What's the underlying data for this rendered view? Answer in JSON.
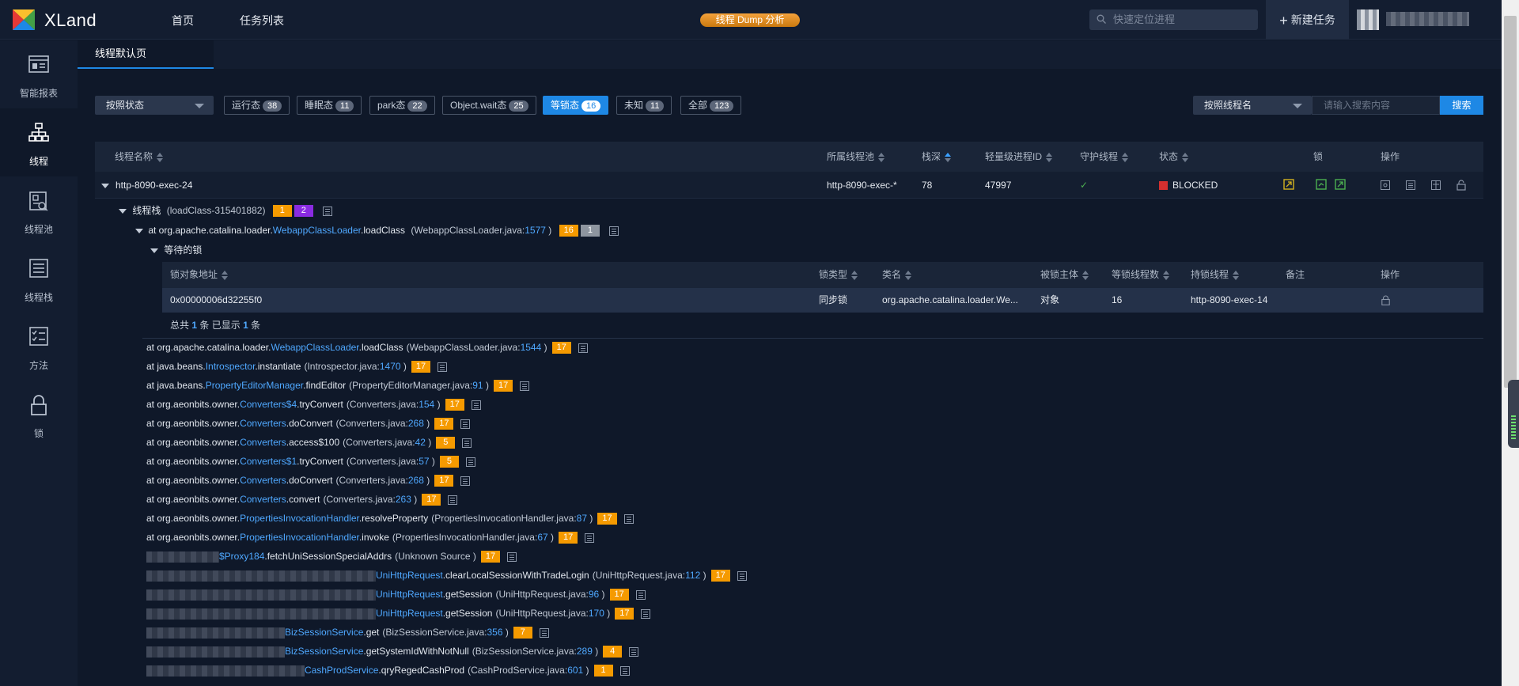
{
  "app": {
    "name": "XLand"
  },
  "nav": {
    "home": "首页",
    "tasks": "任务列表"
  },
  "header": {
    "badge": "线程 Dump 分析",
    "search_placeholder": "快速定位进程",
    "new_task": "新建任务"
  },
  "sidebar": [
    {
      "label": "智能报表",
      "icon": "report-icon"
    },
    {
      "label": "线程",
      "icon": "thread-tree-icon"
    },
    {
      "label": "线程池",
      "icon": "thread-pool-icon"
    },
    {
      "label": "线程栈",
      "icon": "thread-stack-icon"
    },
    {
      "label": "方法",
      "icon": "method-icon"
    },
    {
      "label": "锁",
      "icon": "lock-icon"
    }
  ],
  "tab": {
    "label": "线程默认页"
  },
  "filters": {
    "state_select": "按照状态",
    "pills": [
      {
        "label": "运行态",
        "count": "38"
      },
      {
        "label": "睡眠态",
        "count": "11"
      },
      {
        "label": "park态",
        "count": "22"
      },
      {
        "label": "Object.wait态",
        "count": "25"
      },
      {
        "label": "等锁态",
        "count": "16"
      },
      {
        "label": "未知",
        "count": "11"
      },
      {
        "label": "全部",
        "count": "123"
      }
    ],
    "name_select": "按照线程名",
    "search_placeholder": "请输入搜索内容",
    "search_button": "搜索"
  },
  "table": {
    "headers": {
      "name": "线程名称",
      "pool": "所属线程池",
      "depth": "栈深",
      "lwp": "轻量级进程ID",
      "daemon": "守护线程",
      "state": "状态",
      "lock": "锁",
      "ops": "操作"
    },
    "row": {
      "name": "http-8090-exec-24",
      "pool": "http-8090-exec-*",
      "depth": "78",
      "lwp": "47997",
      "daemon": "✓",
      "state": "BLOCKED"
    }
  },
  "stack": {
    "header_label": "线程栈",
    "header_detail": "(loadClass-315401882)",
    "header_badges": [
      "1",
      "2"
    ],
    "top_frame": {
      "prefix": "at org.apache.catalina.loader.",
      "cls": "WebappClassLoader",
      "method": ".loadClass",
      "file": "WebappClassLoader.java",
      "line": "1577",
      "badges": [
        "16",
        "1"
      ]
    },
    "waiting_lock_label": "等待的锁",
    "lock_headers": {
      "addr": "锁对象地址",
      "type": "锁类型",
      "cls": "类名",
      "subject": "被锁主体",
      "waiters": "等锁线程数",
      "holder": "持锁线程",
      "note": "备注",
      "ops": "操作"
    },
    "lock_row": {
      "addr": "0x00000006d32255f0",
      "type": "同步锁",
      "cls": "org.apache.catalina.loader.We...",
      "subject": "对象",
      "waiters": "16",
      "holder": "http-8090-exec-14",
      "note": ""
    },
    "lock_summary": {
      "a": "总共",
      "n1": "1",
      "b": "条 已显示",
      "n2": "1",
      "c": "条"
    },
    "frames": [
      {
        "prefix": "at org.apache.catalina.loader.",
        "cls": "WebappClassLoader",
        "method": ".loadClass",
        "file": "WebappClassLoader.java",
        "line": "1544",
        "badge": "17"
      },
      {
        "prefix": "at java.beans.",
        "cls": "Introspector",
        "method": ".instantiate",
        "file": "Introspector.java",
        "line": "1470",
        "badge": "17"
      },
      {
        "prefix": "at java.beans.",
        "cls": "PropertyEditorManager",
        "method": ".findEditor",
        "file": "PropertyEditorManager.java",
        "line": "91",
        "badge": "17"
      },
      {
        "prefix": "at org.aeonbits.owner.",
        "cls": "Converters$4",
        "method": ".tryConvert",
        "file": "Converters.java",
        "line": "154",
        "badge": "17"
      },
      {
        "prefix": "at org.aeonbits.owner.",
        "cls": "Converters",
        "method": ".doConvert",
        "file": "Converters.java",
        "line": "268",
        "badge": "17"
      },
      {
        "prefix": "at org.aeonbits.owner.",
        "cls": "Converters",
        "method": ".access$100",
        "file": "Converters.java",
        "line": "42",
        "badge": "5"
      },
      {
        "prefix": "at org.aeonbits.owner.",
        "cls": "Converters$1",
        "method": ".tryConvert",
        "file": "Converters.java",
        "line": "57",
        "badge": "5"
      },
      {
        "prefix": "at org.aeonbits.owner.",
        "cls": "Converters",
        "method": ".doConvert",
        "file": "Converters.java",
        "line": "268",
        "badge": "17"
      },
      {
        "prefix": "at org.aeonbits.owner.",
        "cls": "Converters",
        "method": ".convert",
        "file": "Converters.java",
        "line": "263",
        "badge": "17"
      },
      {
        "prefix": "at org.aeonbits.owner.",
        "cls": "PropertiesInvocationHandler",
        "method": ".resolveProperty",
        "file": "PropertiesInvocationHandler.java",
        "line": "87",
        "badge": "17"
      },
      {
        "prefix": "at org.aeonbits.owner.",
        "cls": "PropertiesInvocationHandler",
        "method": ".invoke",
        "file": "PropertiesInvocationHandler.java",
        "line": "67",
        "badge": "17"
      },
      {
        "prefix": "",
        "cls": "$Proxy184",
        "method": ".fetchUniSessionSpecialAddrs",
        "file": "Unknown Source",
        "line": "",
        "badge": "17",
        "blur": 1
      },
      {
        "prefix": "",
        "cls": "UniHttpRequest",
        "method": ".clearLocalSessionWithTradeLogin",
        "file": "UniHttpRequest.java",
        "line": "112",
        "badge": "17",
        "blur": 2
      },
      {
        "prefix": "",
        "cls": "UniHttpRequest",
        "method": ".getSession",
        "file": "UniHttpRequest.java",
        "line": "96",
        "badge": "17",
        "blur": 2
      },
      {
        "prefix": "",
        "cls": "UniHttpRequest",
        "method": ".getSession",
        "file": "UniHttpRequest.java",
        "line": "170",
        "badge": "17",
        "blur": 2
      },
      {
        "prefix": "",
        "cls": "BizSessionService",
        "method": ".get",
        "file": "BizSessionService.java",
        "line": "356",
        "badge": "7",
        "blur": 3
      },
      {
        "prefix": "",
        "cls": "BizSessionService",
        "method": ".getSystemIdWithNotNull",
        "file": "BizSessionService.java",
        "line": "289",
        "badge": "4",
        "blur": 3
      },
      {
        "prefix": "",
        "cls": "CashProdService",
        "method": ".qryRegedCashProd",
        "file": "CashProdService.java",
        "line": "601",
        "badge": "1",
        "blur": 4
      }
    ]
  },
  "colors": {
    "accent": "#1e88e5",
    "badge": "#f59a00",
    "blocked": "#d32f2f",
    "link": "#4fa8ff"
  }
}
